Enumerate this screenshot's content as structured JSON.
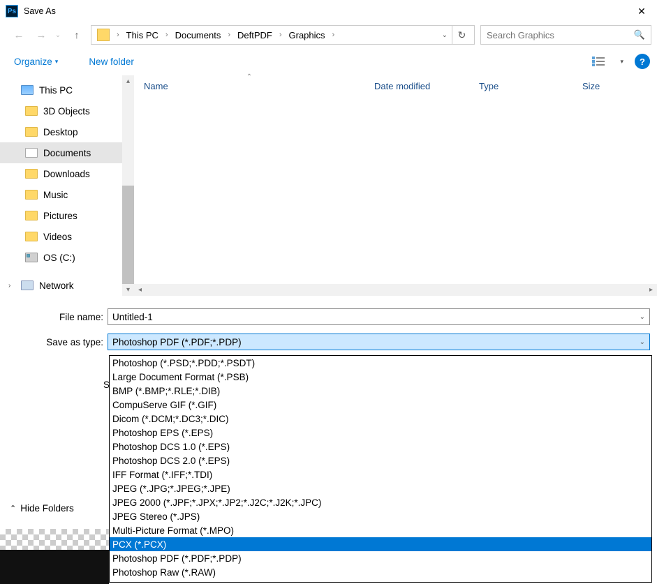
{
  "window": {
    "title": "Save As"
  },
  "breadcrumb": {
    "items": [
      "This PC",
      "Documents",
      "DeftPDF",
      "Graphics"
    ]
  },
  "search": {
    "placeholder": "Search Graphics"
  },
  "toolbar": {
    "organize": "Organize",
    "new_folder": "New folder"
  },
  "tree": {
    "this_pc": "This PC",
    "objects3d": "3D Objects",
    "desktop": "Desktop",
    "documents": "Documents",
    "downloads": "Downloads",
    "music": "Music",
    "pictures": "Pictures",
    "videos": "Videos",
    "osc": "OS (C:)",
    "network": "Network"
  },
  "columns": {
    "name": "Name",
    "date_modified": "Date modified",
    "type": "Type",
    "size": "Size"
  },
  "fields": {
    "file_name_label": "File name:",
    "file_name_value": "Untitled-1",
    "save_type_label": "Save as type:",
    "save_type_value": "Photoshop PDF (*.PDF;*.PDP)"
  },
  "hide_folders": "Hide Folders",
  "dropdown": {
    "selected_index": 13,
    "items": [
      "Photoshop (*.PSD;*.PDD;*.PSDT)",
      "Large Document Format (*.PSB)",
      "BMP (*.BMP;*.RLE;*.DIB)",
      "CompuServe GIF (*.GIF)",
      "Dicom (*.DCM;*.DC3;*.DIC)",
      "Photoshop EPS (*.EPS)",
      "Photoshop DCS 1.0 (*.EPS)",
      "Photoshop DCS 2.0 (*.EPS)",
      "IFF Format (*.IFF;*.TDI)",
      "JPEG (*.JPG;*.JPEG;*.JPE)",
      "JPEG 2000 (*.JPF;*.JPX;*.JP2;*.J2C;*.J2K;*.JPC)",
      "JPEG Stereo (*.JPS)",
      "Multi-Picture Format (*.MPO)",
      "PCX (*.PCX)",
      "Photoshop PDF (*.PDF;*.PDP)",
      "Photoshop Raw (*.RAW)"
    ]
  }
}
